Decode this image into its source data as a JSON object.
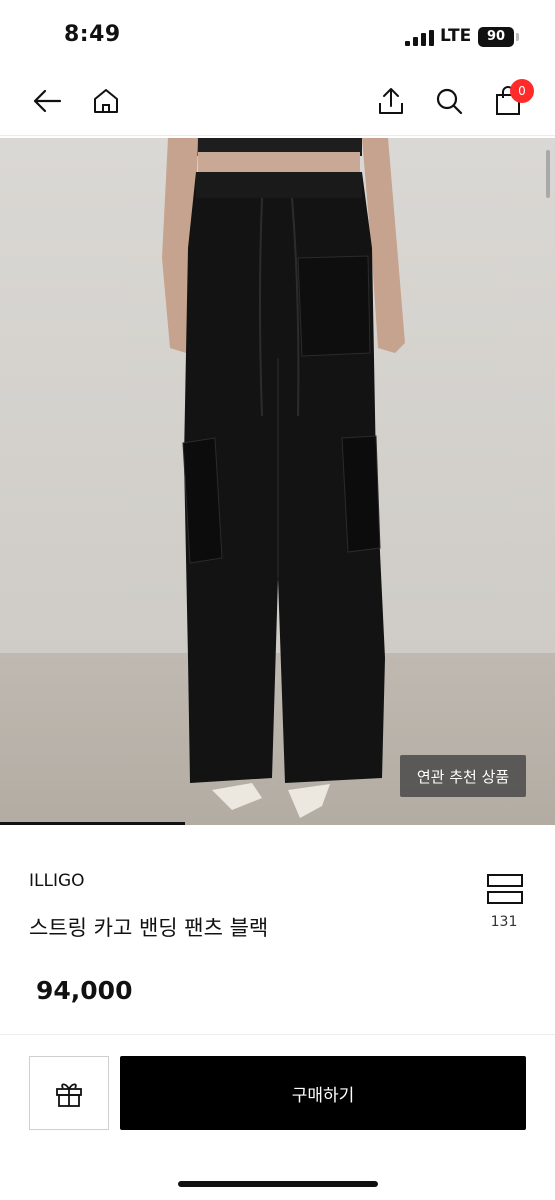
{
  "status_bar": {
    "time": "8:49",
    "network": "LTE",
    "battery": "90"
  },
  "nav": {
    "icons": [
      "back-arrow-icon",
      "home-icon",
      "share-icon",
      "search-icon",
      "cart-icon"
    ],
    "cart_count": "0"
  },
  "product": {
    "related_label": "연관 추천 상품",
    "brand": "ILLIGO",
    "name": "스트링 카고 밴딩 팬츠 블랙",
    "wish_count": "131",
    "price": "94,000"
  },
  "actions": {
    "gift_icon": "gift-icon",
    "buy_label": "구매하기"
  },
  "colors": {
    "accent_badge": "#ff2a2a",
    "buy_button": "#000000"
  }
}
